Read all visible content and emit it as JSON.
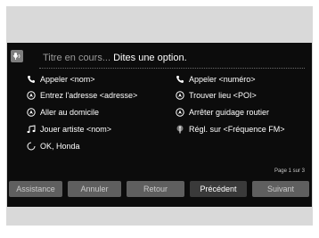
{
  "header": {
    "title_dim": "Titre en cours...",
    "title_bright": "Dites une option."
  },
  "commands": {
    "left": [
      {
        "label": "Appeler <nom>",
        "icon": "phone-icon"
      },
      {
        "label": "Entrez l'adresse <adresse>",
        "icon": "compass-icon"
      },
      {
        "label": "Aller au domicile",
        "icon": "compass-icon"
      },
      {
        "label": "Jouer artiste <nom>",
        "icon": "music-note-icon"
      },
      {
        "label": "OK, Honda",
        "icon": "refresh-icon"
      }
    ],
    "right": [
      {
        "label": "Appeler <numéro>",
        "icon": "phone-icon"
      },
      {
        "label": "Trouver lieu <POI>",
        "icon": "compass-icon"
      },
      {
        "label": "Arrêter guidage routier",
        "icon": "compass-icon"
      },
      {
        "label": "Régl. sur <Fréquence FM>",
        "icon": "antenna-icon"
      }
    ]
  },
  "page": {
    "label": "Page 1 sur 3"
  },
  "buttons": {
    "assistance": "Assistance",
    "annuler": "Annuler",
    "retour": "Retour",
    "precedent": "Précédent",
    "suivant": "Suivant"
  },
  "colors": {
    "screen_bg": "#0c0c0c",
    "button_bg": "#5f5f5f",
    "button_active_bg": "#3a3a3a",
    "outer_bg": "#d9d9d9"
  }
}
